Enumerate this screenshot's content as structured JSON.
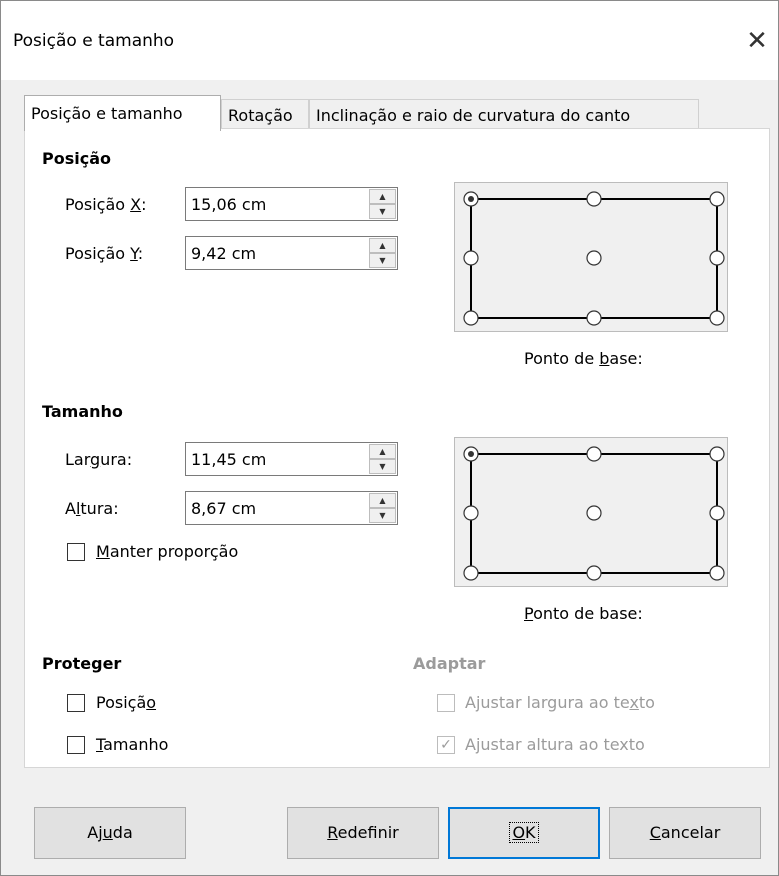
{
  "window": {
    "title": "Posição e tamanho",
    "close_glyph": "✕"
  },
  "tabs": [
    {
      "label": "Posição e tamanho"
    },
    {
      "label": "Rotação"
    },
    {
      "label": "Inclinação e raio de curvatura do canto"
    }
  ],
  "position": {
    "heading": "Posição",
    "x_label_pre": "Posição ",
    "x_label_key": "X",
    "x_label_post": ":",
    "x_value": "15,06 cm",
    "y_label_pre": "Posição ",
    "y_label_key": "Y",
    "y_label_post": ":",
    "y_value": "9,42 cm",
    "base_label_pre": "Ponto de ",
    "base_label_key": "b",
    "base_label_post": "ase:"
  },
  "size": {
    "heading": "Tamanho",
    "width_label_pre": "Lar",
    "width_label_key": "g",
    "width_label_post": "ura:",
    "width_value": "11,45 cm",
    "height_label_pre": "A",
    "height_label_key": "l",
    "height_label_post": "tura:",
    "height_value": "8,67 cm",
    "keep_ratio_key": "M",
    "keep_ratio_post": "anter proporção",
    "base_label_key": "P",
    "base_label_post": "onto de base:"
  },
  "protect": {
    "heading": "Proteger",
    "position_pre": "Posiçã",
    "position_key": "o",
    "size_key": "T",
    "size_post": "amanho"
  },
  "adapt": {
    "heading": "Adaptar",
    "fit_width_pre": "Ajustar largura ao te",
    "fit_width_key": "x",
    "fit_width_post": "to",
    "fit_height_pre": "A",
    "fit_height_key": "j",
    "fit_height_post": "ustar altura ao texto",
    "fit_height_check": "✓"
  },
  "buttons": {
    "help_pre": "Aj",
    "help_key": "u",
    "help_post": "da",
    "reset_key": "R",
    "reset_post": "edefinir",
    "ok_key": "O",
    "ok_post": "K",
    "cancel_key": "C",
    "cancel_post": "ancelar"
  },
  "icons": {
    "spin_up": "▲",
    "spin_down": "▼"
  }
}
